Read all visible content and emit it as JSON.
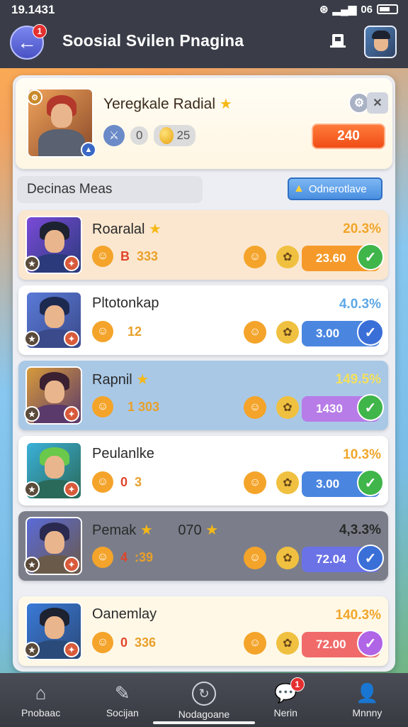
{
  "status_bar": {
    "time": "19.1431",
    "indicator": "06"
  },
  "header": {
    "title": "Soosial Svilen Pnagina",
    "back_badge": "1"
  },
  "featured": {
    "name": "Yeregkale Radial",
    "stat_a": "0",
    "stat_b": "25",
    "button": "240"
  },
  "section": {
    "label": "Decinas Meas",
    "button": "Odnerotlave"
  },
  "rows": [
    {
      "name": "Roaralal",
      "star": true,
      "percent": "20.3%",
      "stat_prefix": "B",
      "stat": "333",
      "action": "23.60",
      "bg": "#fbe7cf",
      "action_color": "#f59a2a",
      "check_color": "#3fb54a",
      "check_glyph": "✓",
      "percent_color": "#f0a62a"
    },
    {
      "name": "Pltotonkap",
      "star": false,
      "percent": "4.0.3%",
      "stat_prefix": "",
      "stat": "12",
      "action": "3.00",
      "bg": "#ffffff",
      "action_color": "#4a86e0",
      "check_color": "#3a6fd8",
      "check_glyph": "✓",
      "percent_color": "#5ea8e6"
    },
    {
      "name": "Rapnil",
      "star": true,
      "percent": "149.5%",
      "stat_prefix": "",
      "stat": "1 303",
      "action": "1430",
      "bg": "#a9c8e6",
      "action_color": "#b77ce8",
      "check_color": "#3fb54a",
      "check_glyph": "✓",
      "percent_color": "#f4e05c"
    },
    {
      "name": "Peulanlke",
      "star": false,
      "percent": "10.3%",
      "stat_prefix": "0",
      "stat": "3",
      "action": "3.00",
      "bg": "#ffffff",
      "action_color": "#4a86e0",
      "check_color": "#3fb54a",
      "check_glyph": "✓",
      "percent_color": "#f0a62a"
    },
    {
      "name": "Pemak",
      "extra": "070",
      "star": true,
      "percent": "4,3.3%",
      "stat_prefix": "4",
      "stat": ":39",
      "action": "72.04",
      "bg": "#7b7e8a",
      "action_color": "#6a72e6",
      "check_color": "#3a6fd8",
      "check_glyph": "✓",
      "percent_color": "#2a2a2a"
    },
    {
      "name": "Oanemlay",
      "star": false,
      "percent": "140.3%",
      "stat_prefix": "0",
      "stat": "336",
      "action": "72.00",
      "bg": "#fff8e7",
      "action_color": "#f06a6a",
      "check_color": "#b064e6",
      "check_glyph": "✓",
      "percent_color": "#f0a62a"
    }
  ],
  "nav": [
    {
      "label": "Pnobaac",
      "icon": "home-icon",
      "badge": ""
    },
    {
      "label": "Socijan",
      "icon": "edit-icon",
      "badge": ""
    },
    {
      "label": "Nodagoane",
      "icon": "refresh-icon",
      "badge": ""
    },
    {
      "label": "Nerin",
      "icon": "chat-icon",
      "badge": "1"
    },
    {
      "label": "Mnnny",
      "icon": "profile-icon",
      "badge": ""
    }
  ]
}
